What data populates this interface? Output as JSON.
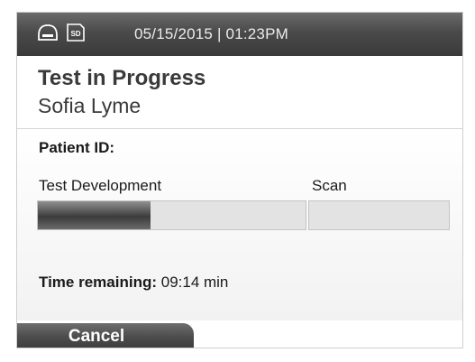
{
  "status_bar": {
    "datetime": "05/15/2015 | 01:23PM",
    "icons": [
      "drive-icon",
      "sd-card-icon"
    ],
    "sd_label": "SD"
  },
  "header": {
    "title": "Test in Progress",
    "patient_name": "Sofia Lyme"
  },
  "patient": {
    "id_label": "Patient ID:",
    "id_value": ""
  },
  "stages": [
    {
      "label": "Test Development",
      "progress": 0.42
    },
    {
      "label": "Scan",
      "progress": 0.0
    }
  ],
  "time_remaining": {
    "label": "Time remaining:",
    "value": "09:14 min"
  },
  "footer": {
    "cancel_label": "Cancel"
  },
  "colors": {
    "status_bar": "#4a4a4a",
    "progress_fill": "#3c3c3c",
    "progress_track": "#e3e3e3",
    "button": "#4c4c4c"
  }
}
